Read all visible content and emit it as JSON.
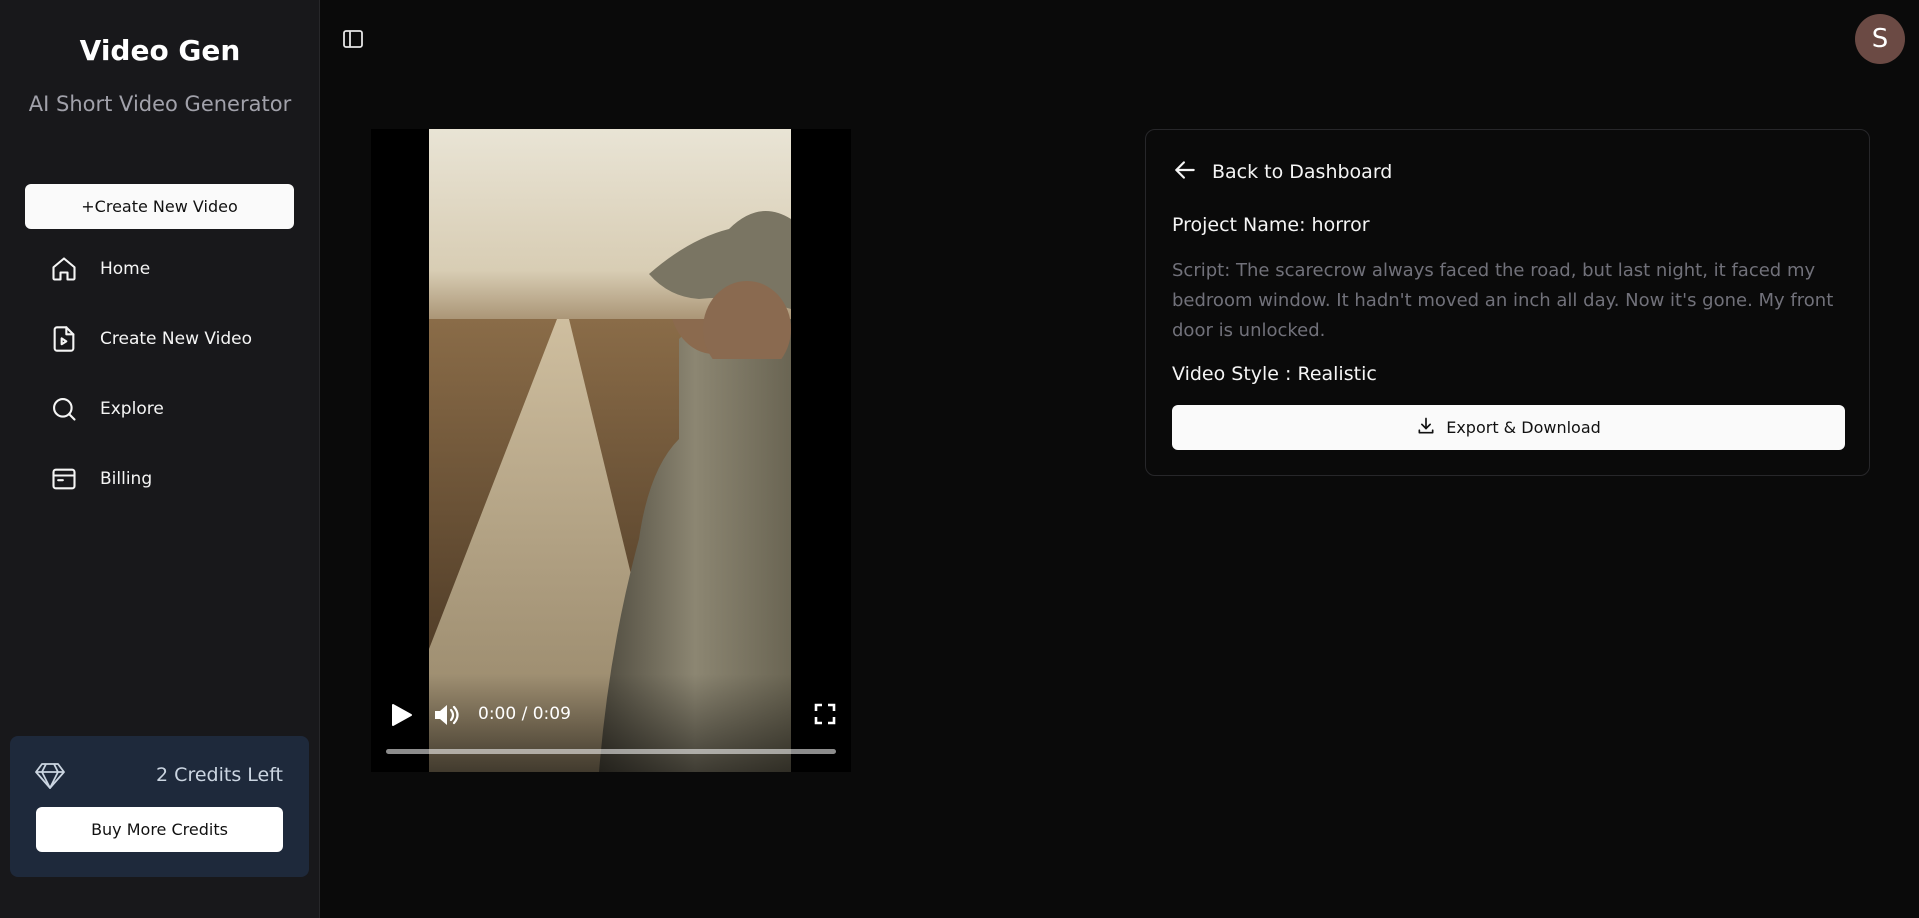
{
  "sidebar": {
    "brand_title": "Video Gen",
    "brand_subtitle": "AI Short Video Generator",
    "create_button": "+Create New Video",
    "nav": [
      {
        "label": "Home",
        "icon": "home-icon"
      },
      {
        "label": "Create New Video",
        "icon": "file-video-icon"
      },
      {
        "label": "Explore",
        "icon": "search-icon"
      },
      {
        "label": "Billing",
        "icon": "wallet-icon"
      }
    ],
    "credits": {
      "icon": "gem-icon",
      "text": "2 Credits Left",
      "buy_button": "Buy More Credits"
    }
  },
  "header": {
    "toggle_icon": "panel-left-icon",
    "avatar_initial": "S",
    "avatar_color": "#6b4a44"
  },
  "player": {
    "time": "0:00 / 0:09",
    "progress": 0,
    "controls": [
      "play-icon",
      "volume-icon",
      "fullscreen-icon"
    ]
  },
  "details": {
    "back_label": "Back to Dashboard",
    "project_name": "Project Name: horror",
    "script": "Script: The scarecrow always faced the road, but last night, it faced my bedroom window. It hadn't moved an inch all day. Now it's gone. My front door is unlocked.",
    "video_style": "Video Style : Realistic",
    "export_button": "Export & Download"
  },
  "colors": {
    "background": "#0a0a0a",
    "sidebar": "#18181b",
    "credits_card": "#1e293b",
    "muted_text": "#71717a"
  }
}
